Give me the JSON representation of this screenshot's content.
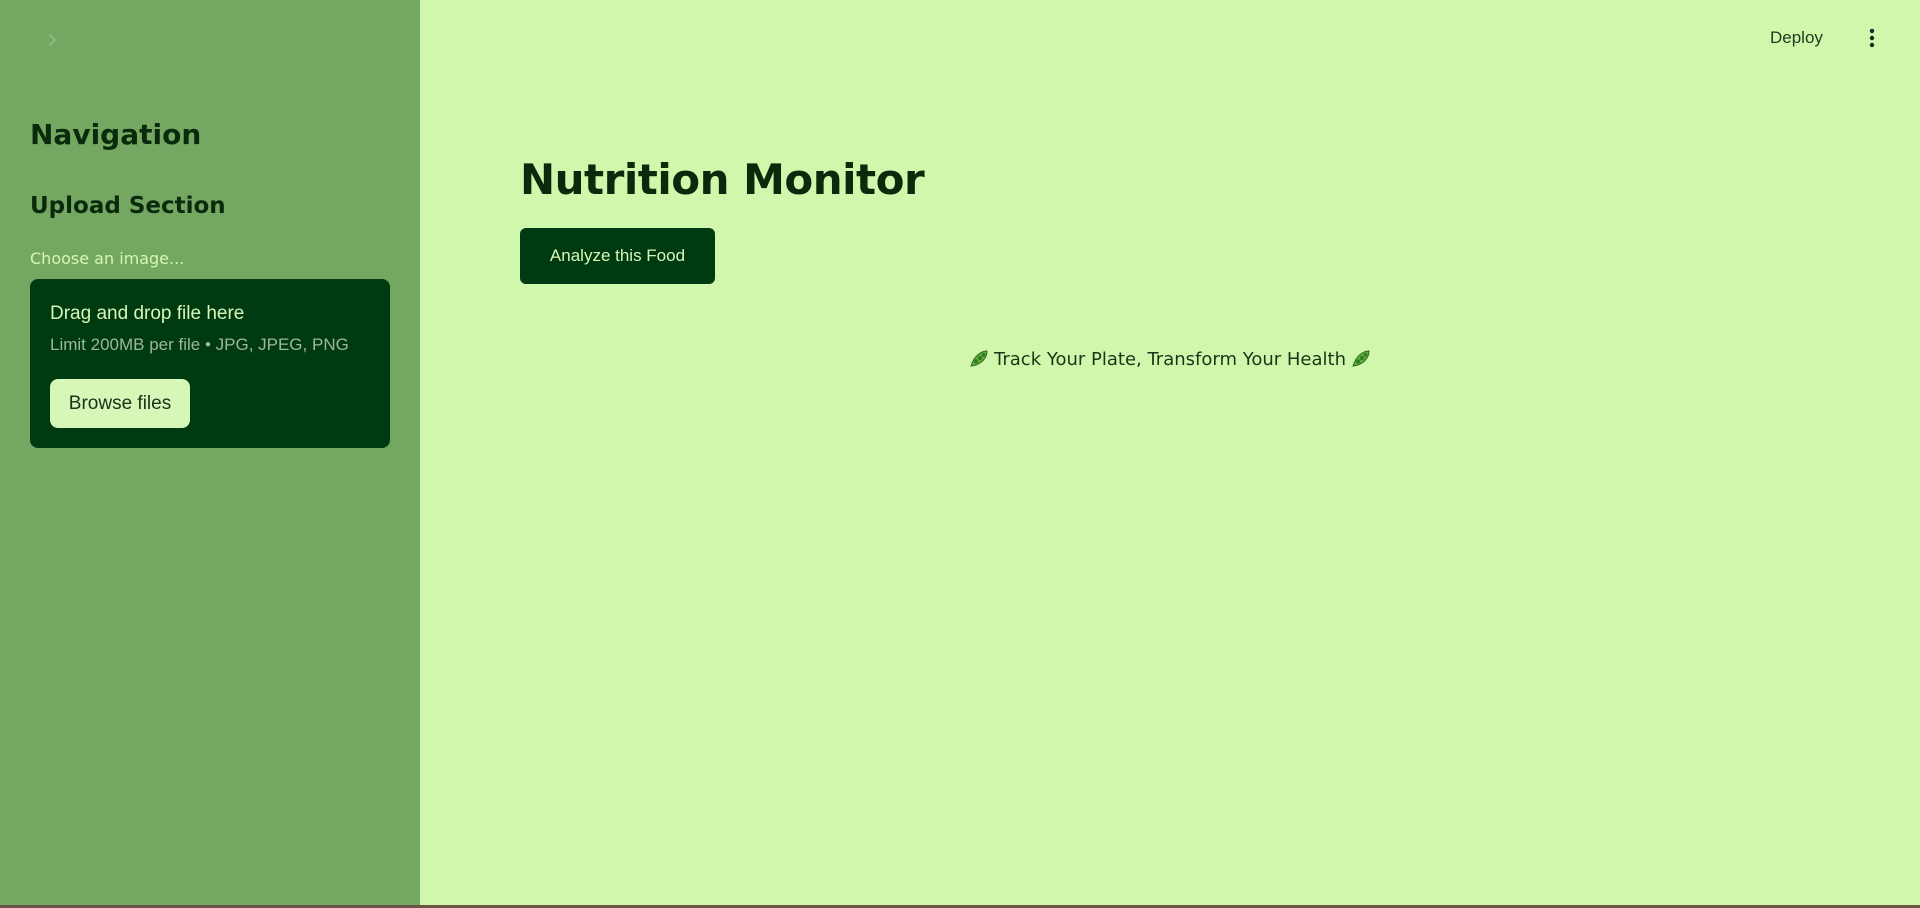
{
  "sidebar": {
    "collapse_icon": "chevron-right-icon",
    "title": "Navigation",
    "section_title": "Upload Section",
    "uploader": {
      "label": "Choose an image...",
      "dropzone_title": "Drag and drop file here",
      "limit_text": "Limit 200MB per file • JPG, JPEG, PNG",
      "browse_label": "Browse files"
    }
  },
  "header": {
    "deploy_label": "Deploy",
    "menu_icon": "kebab-menu-icon"
  },
  "main": {
    "title": "Nutrition Monitor",
    "analyze_label": "Analyze this Food",
    "tagline": "Track Your Plate, Transform Your Health",
    "tagline_icon": "pea-pod-icon"
  },
  "colors": {
    "sidebar_bg": "#74a762",
    "main_bg": "#d0f7ac",
    "primary_dark": "#003a10",
    "light_button": "#d6f7b8"
  }
}
